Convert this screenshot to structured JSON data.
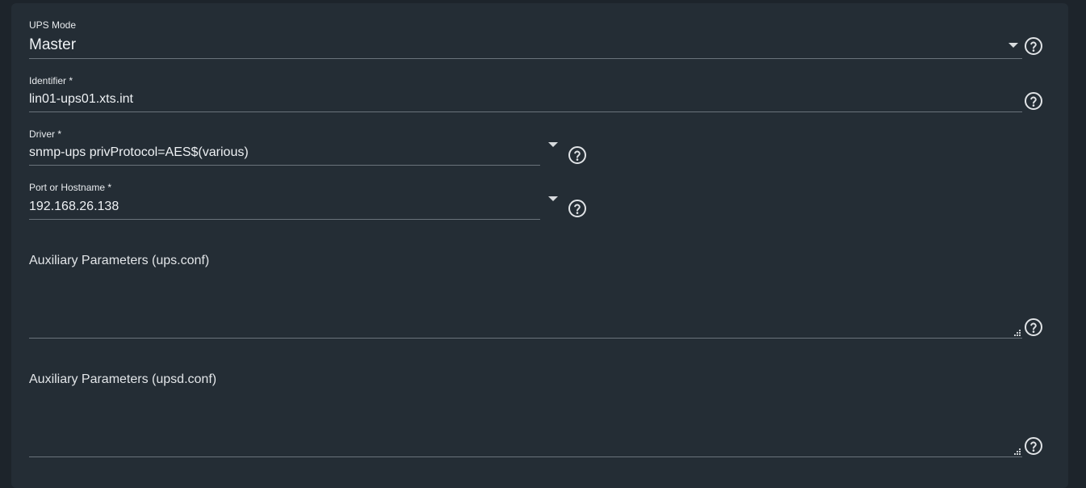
{
  "form": {
    "ups_mode": {
      "label": "UPS Mode",
      "value": "Master"
    },
    "identifier": {
      "label": "Identifier *",
      "value": "lin01-ups01.xts.int"
    },
    "driver": {
      "label": "Driver *",
      "value": "snmp-ups privProtocol=AES$(various)"
    },
    "port": {
      "label": "Port or Hostname *",
      "value": "192.168.26.138"
    },
    "aux_ups": {
      "label": "Auxiliary Parameters (ups.conf)",
      "value": ""
    },
    "aux_upsd": {
      "label": "Auxiliary Parameters (upsd.conf)",
      "value": ""
    }
  },
  "icons": {
    "help": "help-circle-icon",
    "dropdown": "caret-down-icon",
    "resize": "resize-grip-icon"
  },
  "colors": {
    "page_bg": "#1d242b",
    "card_bg": "#242d35",
    "text": "#eef1f4",
    "underline": "#6a737b"
  }
}
